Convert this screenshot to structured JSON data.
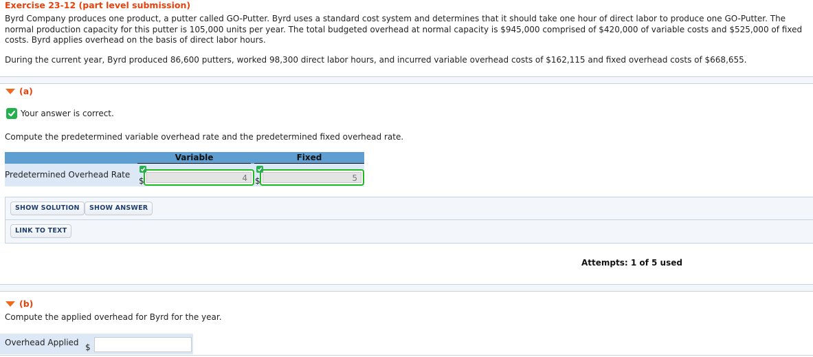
{
  "exercise": {
    "title": "Exercise 23-12 (part level submission)",
    "problem_text": "Byrd Company produces one product, a putter called GO-Putter. Byrd uses a standard cost system and determines that it should take one hour of direct labor to produce one GO-Putter. The normal production capacity for this putter is 105,000 units per year. The total budgeted overhead at normal capacity is $945,000 comprised of $420,000 of variable costs and $525,000 of fixed costs. Byrd applies overhead on the basis of direct labor hours.",
    "current_year_text": "During the current year, Byrd produced 86,600 putters, worked 98,300 direct labor hours, and incurred variable overhead costs of $162,115 and fixed overhead costs of $668,655."
  },
  "part_a": {
    "label": "(a)",
    "status": "Your answer is correct.",
    "prompt": "Compute the predetermined variable overhead rate and the predetermined fixed overhead rate.",
    "table": {
      "columns": [
        "Variable",
        "Fixed"
      ],
      "row_label": "Predetermined Overhead Rate",
      "currency": "$",
      "values": [
        "4",
        "5"
      ]
    },
    "buttons": {
      "show_solution": "SHOW SOLUTION",
      "show_answer": "SHOW ANSWER",
      "link_to_text": "LINK TO TEXT"
    },
    "attempts": "Attempts: 1 of 5 used"
  },
  "part_b": {
    "label": "(b)",
    "prompt": "Compute the applied overhead for Byrd for the year.",
    "row_label": "Overhead Applied",
    "currency": "$",
    "value": ""
  },
  "colors": {
    "accent_orange": "#e8420c",
    "correct_green": "#22b14c",
    "table_header_blue": "#5f9ed1",
    "table_row_blue": "#dce8f6"
  }
}
